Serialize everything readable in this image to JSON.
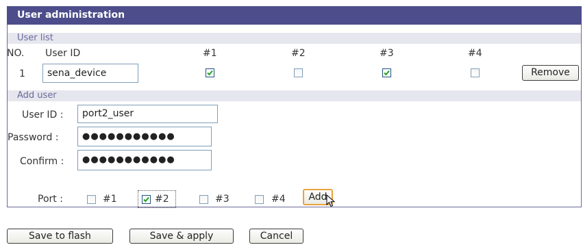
{
  "panel": {
    "title": "User administration"
  },
  "user_list": {
    "section_label": "User list",
    "columns": {
      "no": "NO.",
      "user_id": "User ID",
      "p1": "#1",
      "p2": "#2",
      "p3": "#3",
      "p4": "#4"
    },
    "rows": [
      {
        "no": "1",
        "user_id": "sena_device",
        "ports": [
          true,
          false,
          true,
          false
        ],
        "remove_label": "Remove"
      }
    ]
  },
  "add_user": {
    "section_label": "Add user",
    "user_id_label": "User ID :",
    "user_id_value": "port2_user",
    "password_label": "Password :",
    "password_value": "●●●●●●●●●●●",
    "confirm_label": "Confirm :",
    "confirm_value": "●●●●●●●●●●●",
    "port_label": "Port :",
    "ports": [
      {
        "label": "#1",
        "checked": false
      },
      {
        "label": "#2",
        "checked": true
      },
      {
        "label": "#3",
        "checked": false
      },
      {
        "label": "#4",
        "checked": false
      }
    ],
    "add_label": "Add"
  },
  "footer": {
    "save_flash_label": "Save to flash",
    "save_apply_label": "Save & apply",
    "cancel_label": "Cancel"
  }
}
